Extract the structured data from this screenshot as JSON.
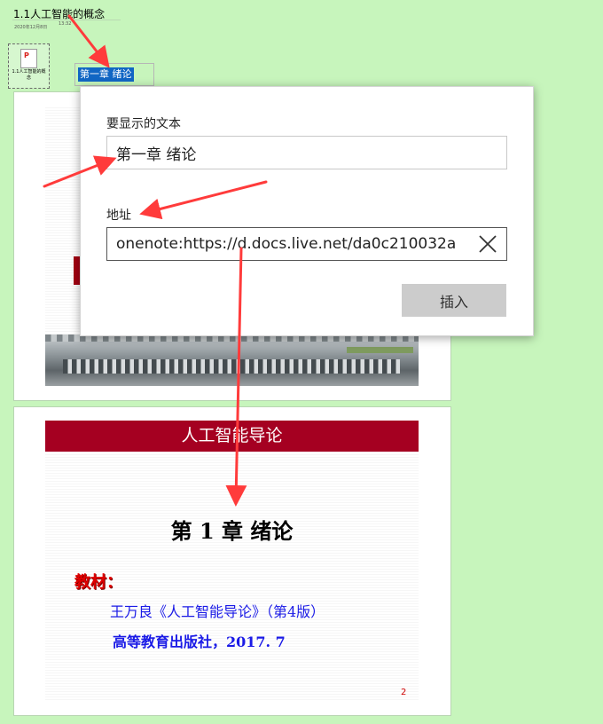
{
  "page": {
    "title": "1.1人工智能的概念",
    "date": "2020年12月8日",
    "time": "13:32"
  },
  "attachment": {
    "icon": "pdf-icon",
    "icon_glyph": "P",
    "caption": "1.1人工智能的概念"
  },
  "selected_link_text": "第一章 绪论",
  "slide1": {
    "accent_color": "#a30012"
  },
  "slide2": {
    "banner": "人工智能导论",
    "heading": "第 1 章   绪论",
    "label": "教材：",
    "line1": "王万良《人工智能导论》（第4版）",
    "line2": "高等教育出版社，2017. 7",
    "page_number": "2",
    "banner_color": "#a50021"
  },
  "dialog": {
    "text_label": "要显示的文本",
    "text_value": "第一章 绪论",
    "address_label": "地址",
    "address_value": "onenote:https://d.docs.live.net/da0c210032a",
    "clear_icon": "close-icon",
    "insert_label": "插入"
  },
  "colors": {
    "canvas": "#c7f5bc",
    "annotation_arrow": "#ff3b3b",
    "selection": "#1166c4"
  }
}
